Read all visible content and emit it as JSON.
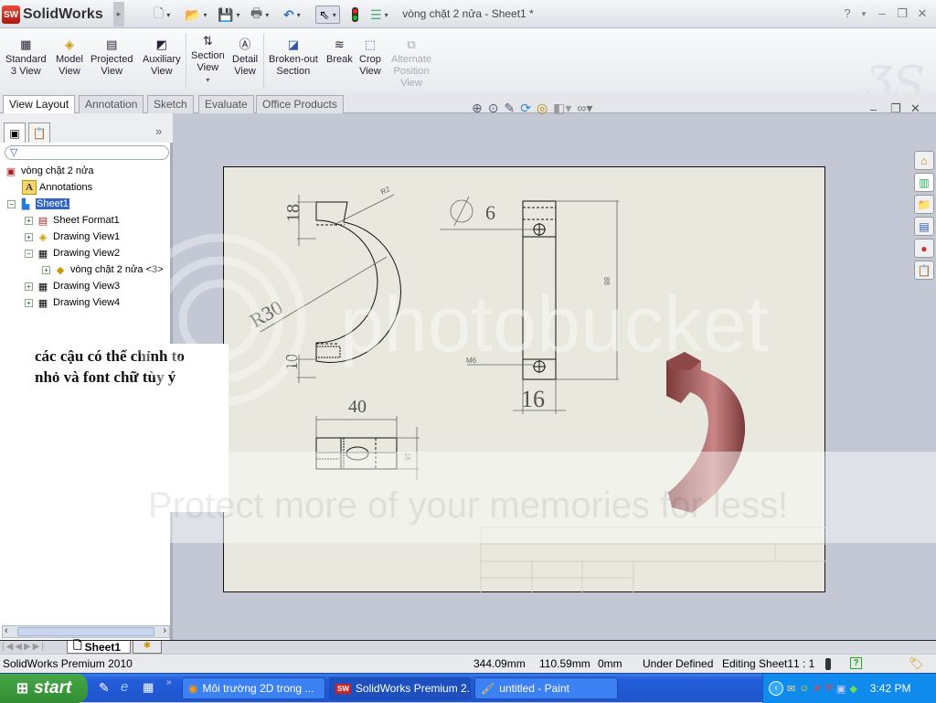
{
  "app": {
    "brand": "SolidWorks",
    "doc_title": "vòng chặt 2 nửa - Sheet1 *"
  },
  "quick_access": [
    {
      "name": "new-icon",
      "glyph": "🗋"
    },
    {
      "name": "open-icon",
      "glyph": "📂"
    },
    {
      "name": "save-icon",
      "glyph": "💾"
    },
    {
      "name": "print-icon",
      "glyph": "🖶"
    },
    {
      "name": "undo-icon",
      "glyph": "↶"
    },
    {
      "name": "select-icon",
      "glyph": "⇖"
    },
    {
      "name": "rebuild-icon",
      "glyph": "●"
    },
    {
      "name": "options-icon",
      "glyph": "☰"
    }
  ],
  "window_controls": {
    "help": "?",
    "minimize": "–",
    "restore": "❐",
    "close": "✕"
  },
  "commands": [
    {
      "label1": "Standard",
      "label2": "3 View",
      "glyph": "▦",
      "disabled": false
    },
    {
      "label1": "Model",
      "label2": "View",
      "glyph": "◈",
      "disabled": false
    },
    {
      "label1": "Projected",
      "label2": "View",
      "glyph": "▤",
      "disabled": false
    },
    {
      "label1": "Auxiliary",
      "label2": "View",
      "glyph": "◩",
      "disabled": false
    },
    {
      "label1": "Section",
      "label2": "View",
      "glyph": "⇅",
      "disabled": false
    },
    {
      "label1": "Detail",
      "label2": "View",
      "glyph": "Ⓐ",
      "disabled": false
    },
    {
      "label1": "Broken-out",
      "label2": "Section",
      "glyph": "◪",
      "disabled": false
    },
    {
      "label1": "Break",
      "label2": "",
      "glyph": "≋",
      "disabled": false
    },
    {
      "label1": "Crop",
      "label2": "View",
      "glyph": "⬚",
      "disabled": false
    },
    {
      "label1": "Alternate",
      "label2": "Position",
      "label3": "View",
      "glyph": "⧉",
      "disabled": true
    }
  ],
  "tabs": [
    "View Layout",
    "Annotation",
    "Sketch",
    "Evaluate",
    "Office Products"
  ],
  "active_tab": "View Layout",
  "tree": {
    "root": "vòng chặt 2 nửa",
    "items": [
      {
        "label": "Annotations",
        "level": 1,
        "expander": ""
      },
      {
        "label": "Sheet1",
        "level": 1,
        "expander": "−",
        "selected": true
      },
      {
        "label": "Sheet Format1",
        "level": 2,
        "expander": "+"
      },
      {
        "label": "Drawing View1",
        "level": 2,
        "expander": "+"
      },
      {
        "label": "Drawing View2",
        "level": 2,
        "expander": "−"
      },
      {
        "label": "vòng chặt 2 nửa <3>",
        "level": 3,
        "expander": "+"
      },
      {
        "label": "Drawing View3",
        "level": 2,
        "expander": "+"
      },
      {
        "label": "Drawing View4",
        "level": 2,
        "expander": "+"
      }
    ]
  },
  "note": {
    "line1": "các cậu có thể chỉnh to",
    "line2": "nhỏ và font chữ tùy ý"
  },
  "drawing": {
    "dims": {
      "d18": "18",
      "r2": "R2",
      "r30": "R30",
      "d10": "10",
      "phi6": "6",
      "d88": "88",
      "m6": "M6",
      "d16": "16",
      "d40": "40",
      "d16b": "16"
    }
  },
  "sheet_tab": "Sheet1",
  "status": {
    "product": "SolidWorks Premium 2010",
    "x": "344.09mm",
    "y": "110.59mm",
    "z": "0mm",
    "state": "Under Defined",
    "editing": "Editing Sheet1",
    "scale": "1 : 1"
  },
  "taskbar": {
    "start": "start",
    "buttons": [
      {
        "label": "Môi trường 2D trong ...",
        "icon": "firefox-icon"
      },
      {
        "label": "SolidWorks Premium 2...",
        "icon": "solidworks-icon",
        "active": true
      },
      {
        "label": "untitled - Paint",
        "icon": "paint-icon"
      }
    ],
    "clock": "3:42 PM"
  },
  "watermark": {
    "brand": "photobucket",
    "tagline": "Protect more of your memories for less!"
  }
}
